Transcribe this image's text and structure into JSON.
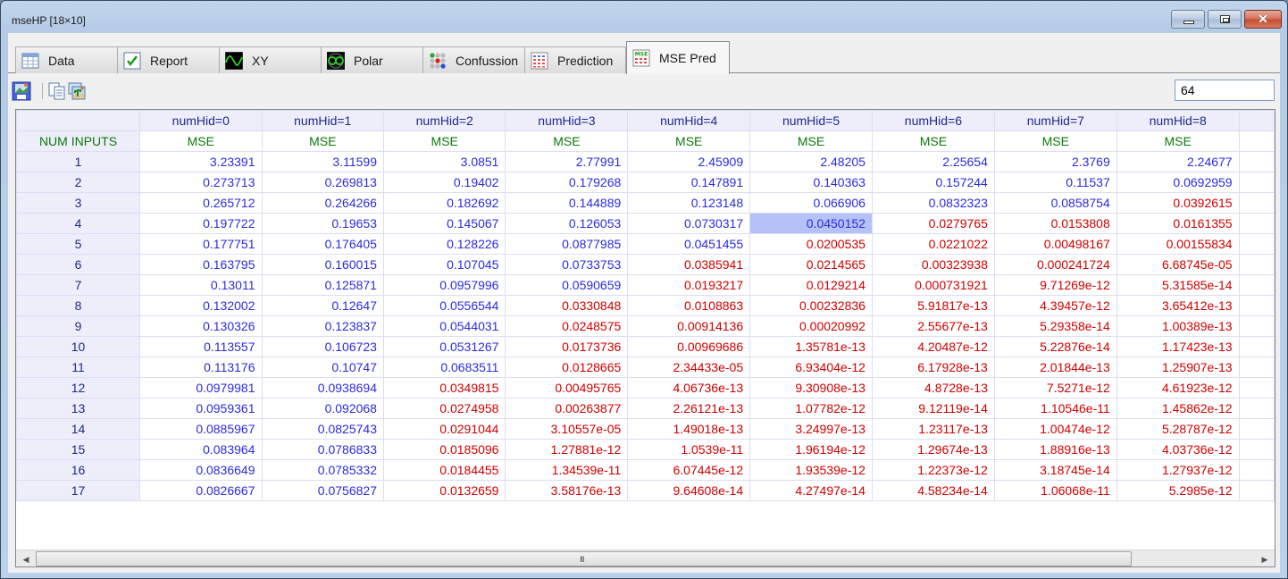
{
  "window": {
    "title": "mseHP [18×10]",
    "buttons": {
      "minimize": "minimize",
      "maximize": "maximize",
      "close": "✕"
    }
  },
  "tabs": [
    {
      "label": "Data",
      "icon": "table-icon",
      "active": false
    },
    {
      "label": "Report",
      "icon": "checkmark-icon",
      "active": false
    },
    {
      "label": "XY",
      "icon": "sine-wave-icon",
      "active": false
    },
    {
      "label": "Polar",
      "icon": "polar-plot-icon",
      "active": false
    },
    {
      "label": "Confussion",
      "icon": "dot-matrix-icon",
      "active": false
    },
    {
      "label": "Prediction",
      "icon": "prediction-grid-icon",
      "active": false
    },
    {
      "label": "MSE Pred",
      "icon": "mse-grid-icon",
      "active": true
    }
  ],
  "toolbar": {
    "buttons": [
      "save-image",
      "copy",
      "export-image"
    ]
  },
  "value_input": {
    "value": "64"
  },
  "grid": {
    "row_header_title": "NUM INPUTS",
    "columns": [
      "numHid=0",
      "numHid=1",
      "numHid=2",
      "numHid=3",
      "numHid=4",
      "numHid=5",
      "numHid=6",
      "numHid=7",
      "numHid=8"
    ],
    "sub_header": "MSE",
    "selected_cell": {
      "row": 4,
      "col": "numHid=5"
    },
    "colors": {
      "above_threshold": "#2b2be0",
      "below_threshold": "#d00000",
      "header_green": "#0a7a0a",
      "selection": "#b4c2f8"
    },
    "rows": [
      {
        "label": "1",
        "values": [
          "3.23391",
          "3.11599",
          "3.0851",
          "2.77991",
          "2.45909",
          "2.48205",
          "2.25654",
          "2.3769",
          "2.24677"
        ],
        "colors": [
          "b",
          "b",
          "b",
          "b",
          "b",
          "b",
          "b",
          "b",
          "b"
        ]
      },
      {
        "label": "2",
        "values": [
          "0.273713",
          "0.269813",
          "0.19402",
          "0.179268",
          "0.147891",
          "0.140363",
          "0.157244",
          "0.11537",
          "0.0692959"
        ],
        "colors": [
          "b",
          "b",
          "b",
          "b",
          "b",
          "b",
          "b",
          "b",
          "b"
        ]
      },
      {
        "label": "3",
        "values": [
          "0.265712",
          "0.264266",
          "0.182692",
          "0.144889",
          "0.123148",
          "0.066906",
          "0.0832323",
          "0.0858754",
          "0.0392615"
        ],
        "colors": [
          "b",
          "b",
          "b",
          "b",
          "b",
          "b",
          "b",
          "b",
          "r"
        ]
      },
      {
        "label": "4",
        "values": [
          "0.197722",
          "0.19653",
          "0.145067",
          "0.126053",
          "0.0730317",
          "0.0450152",
          "0.0279765",
          "0.0153808",
          "0.0161355"
        ],
        "colors": [
          "b",
          "b",
          "b",
          "b",
          "b",
          "b",
          "r",
          "r",
          "r"
        ]
      },
      {
        "label": "5",
        "values": [
          "0.177751",
          "0.176405",
          "0.128226",
          "0.0877985",
          "0.0451455",
          "0.0200535",
          "0.0221022",
          "0.00498167",
          "0.00155834"
        ],
        "colors": [
          "b",
          "b",
          "b",
          "b",
          "b",
          "r",
          "r",
          "r",
          "r"
        ]
      },
      {
        "label": "6",
        "values": [
          "0.163795",
          "0.160015",
          "0.107045",
          "0.0733753",
          "0.0385941",
          "0.0214565",
          "0.00323938",
          "0.000241724",
          "6.68745e-05"
        ],
        "colors": [
          "b",
          "b",
          "b",
          "b",
          "r",
          "r",
          "r",
          "r",
          "r"
        ]
      },
      {
        "label": "7",
        "values": [
          "0.13011",
          "0.125871",
          "0.0957996",
          "0.0590659",
          "0.0193217",
          "0.0129214",
          "0.000731921",
          "9.71269e-12",
          "5.31585e-14"
        ],
        "colors": [
          "b",
          "b",
          "b",
          "b",
          "r",
          "r",
          "r",
          "r",
          "r"
        ]
      },
      {
        "label": "8",
        "values": [
          "0.132002",
          "0.12647",
          "0.0556544",
          "0.0330848",
          "0.0108863",
          "0.00232836",
          "5.91817e-13",
          "4.39457e-12",
          "3.65412e-13"
        ],
        "colors": [
          "b",
          "b",
          "b",
          "r",
          "r",
          "r",
          "r",
          "r",
          "r"
        ]
      },
      {
        "label": "9",
        "values": [
          "0.130326",
          "0.123837",
          "0.0544031",
          "0.0248575",
          "0.00914136",
          "0.00020992",
          "2.55677e-13",
          "5.29358e-14",
          "1.00389e-13"
        ],
        "colors": [
          "b",
          "b",
          "b",
          "r",
          "r",
          "r",
          "r",
          "r",
          "r"
        ]
      },
      {
        "label": "10",
        "values": [
          "0.113557",
          "0.106723",
          "0.0531267",
          "0.0173736",
          "0.00969686",
          "1.35781e-13",
          "4.20487e-12",
          "5.22876e-14",
          "1.17423e-13"
        ],
        "colors": [
          "b",
          "b",
          "b",
          "r",
          "r",
          "r",
          "r",
          "r",
          "r"
        ]
      },
      {
        "label": "11",
        "values": [
          "0.113176",
          "0.10747",
          "0.0683511",
          "0.0128665",
          "2.34433e-05",
          "6.93404e-12",
          "6.17928e-13",
          "2.01844e-13",
          "1.25907e-13"
        ],
        "colors": [
          "b",
          "b",
          "b",
          "r",
          "r",
          "r",
          "r",
          "r",
          "r"
        ]
      },
      {
        "label": "12",
        "values": [
          "0.0979981",
          "0.0938694",
          "0.0349815",
          "0.00495765",
          "4.06736e-13",
          "9.30908e-13",
          "4.8728e-13",
          "7.5271e-12",
          "4.61923e-12"
        ],
        "colors": [
          "b",
          "b",
          "r",
          "r",
          "r",
          "r",
          "r",
          "r",
          "r"
        ]
      },
      {
        "label": "13",
        "values": [
          "0.0959361",
          "0.092068",
          "0.0274958",
          "0.00263877",
          "2.26121e-13",
          "1.07782e-12",
          "9.12119e-14",
          "1.10546e-11",
          "1.45862e-12"
        ],
        "colors": [
          "b",
          "b",
          "r",
          "r",
          "r",
          "r",
          "r",
          "r",
          "r"
        ]
      },
      {
        "label": "14",
        "values": [
          "0.0885967",
          "0.0825743",
          "0.0291044",
          "3.10557e-05",
          "1.49018e-13",
          "3.24997e-13",
          "1.23117e-13",
          "1.00474e-12",
          "5.28787e-12"
        ],
        "colors": [
          "b",
          "b",
          "r",
          "r",
          "r",
          "r",
          "r",
          "r",
          "r"
        ]
      },
      {
        "label": "15",
        "values": [
          "0.083964",
          "0.0786833",
          "0.0185096",
          "1.27881e-12",
          "1.0539e-11",
          "1.96194e-12",
          "1.29674e-13",
          "1.88916e-13",
          "4.03736e-12"
        ],
        "colors": [
          "b",
          "b",
          "r",
          "r",
          "r",
          "r",
          "r",
          "r",
          "r"
        ]
      },
      {
        "label": "16",
        "values": [
          "0.0836649",
          "0.0785332",
          "0.0184455",
          "1.34539e-11",
          "6.07445e-12",
          "1.93539e-12",
          "1.22373e-12",
          "3.18745e-14",
          "1.27937e-12"
        ],
        "colors": [
          "b",
          "b",
          "r",
          "r",
          "r",
          "r",
          "r",
          "r",
          "r"
        ]
      },
      {
        "label": "17",
        "values": [
          "0.0826667",
          "0.0756827",
          "0.0132659",
          "3.58176e-13",
          "9.64608e-14",
          "4.27497e-14",
          "4.58234e-14",
          "1.06068e-11",
          "5.2985e-12"
        ],
        "colors": [
          "b",
          "b",
          "r",
          "r",
          "r",
          "r",
          "r",
          "r",
          "r"
        ]
      }
    ]
  },
  "hscroll": {
    "grip": "III",
    "left_arrow": "◀",
    "right_arrow": "▶"
  }
}
